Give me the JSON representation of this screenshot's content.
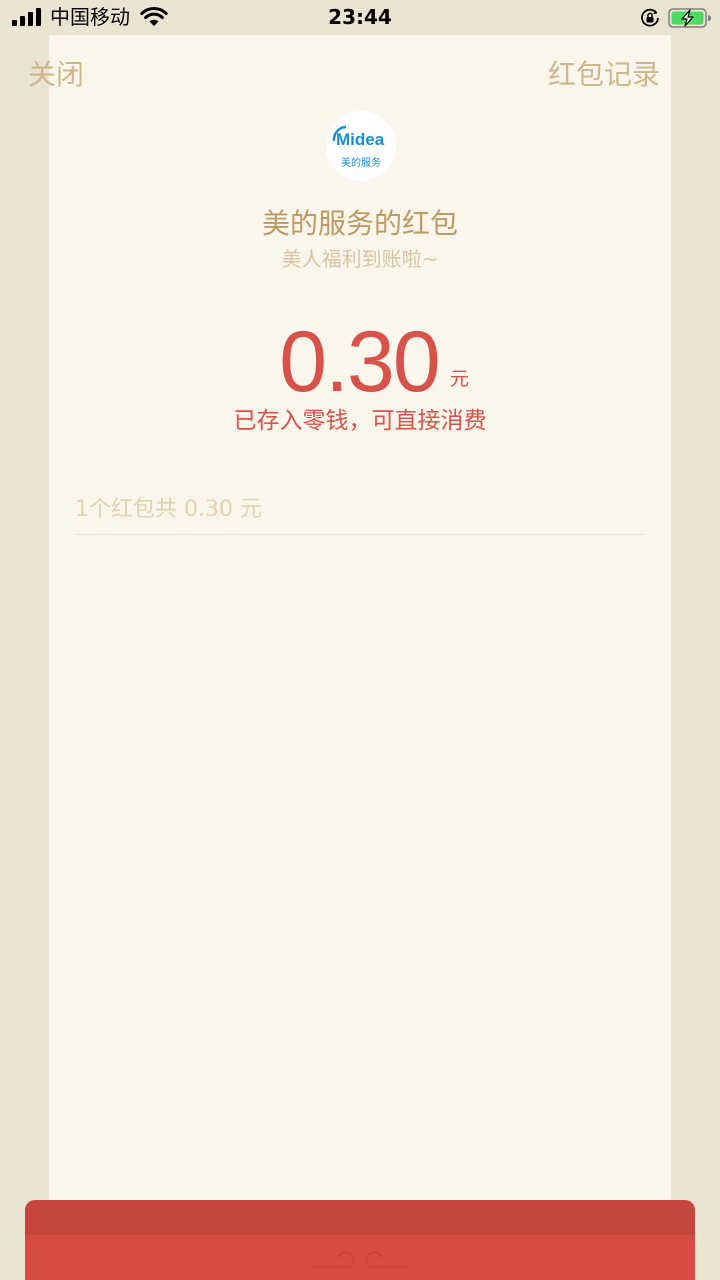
{
  "status_bar": {
    "carrier": "中国移动",
    "time": "23:44",
    "signal_icon": "signal-bars-icon",
    "wifi_icon": "wifi-icon",
    "lock_icon": "orientation-lock-icon",
    "battery_icon": "battery-charging-icon"
  },
  "nav": {
    "close_label": "关闭",
    "records_label": "红包记录"
  },
  "sender": {
    "logo_icon": "midea-logo",
    "title": "美的服务的红包",
    "greeting": "美人福利到账啦~"
  },
  "amount": {
    "value": "0.30",
    "unit": "元",
    "note": "已存入零钱，可直接消费"
  },
  "summary": {
    "text": "1个红包共 0.30 元"
  },
  "colors": {
    "accent_red": "#d6524a",
    "gold_text": "#bd9a62",
    "sheet_background": "#faf6ec",
    "page_background": "#ebe3d1"
  }
}
